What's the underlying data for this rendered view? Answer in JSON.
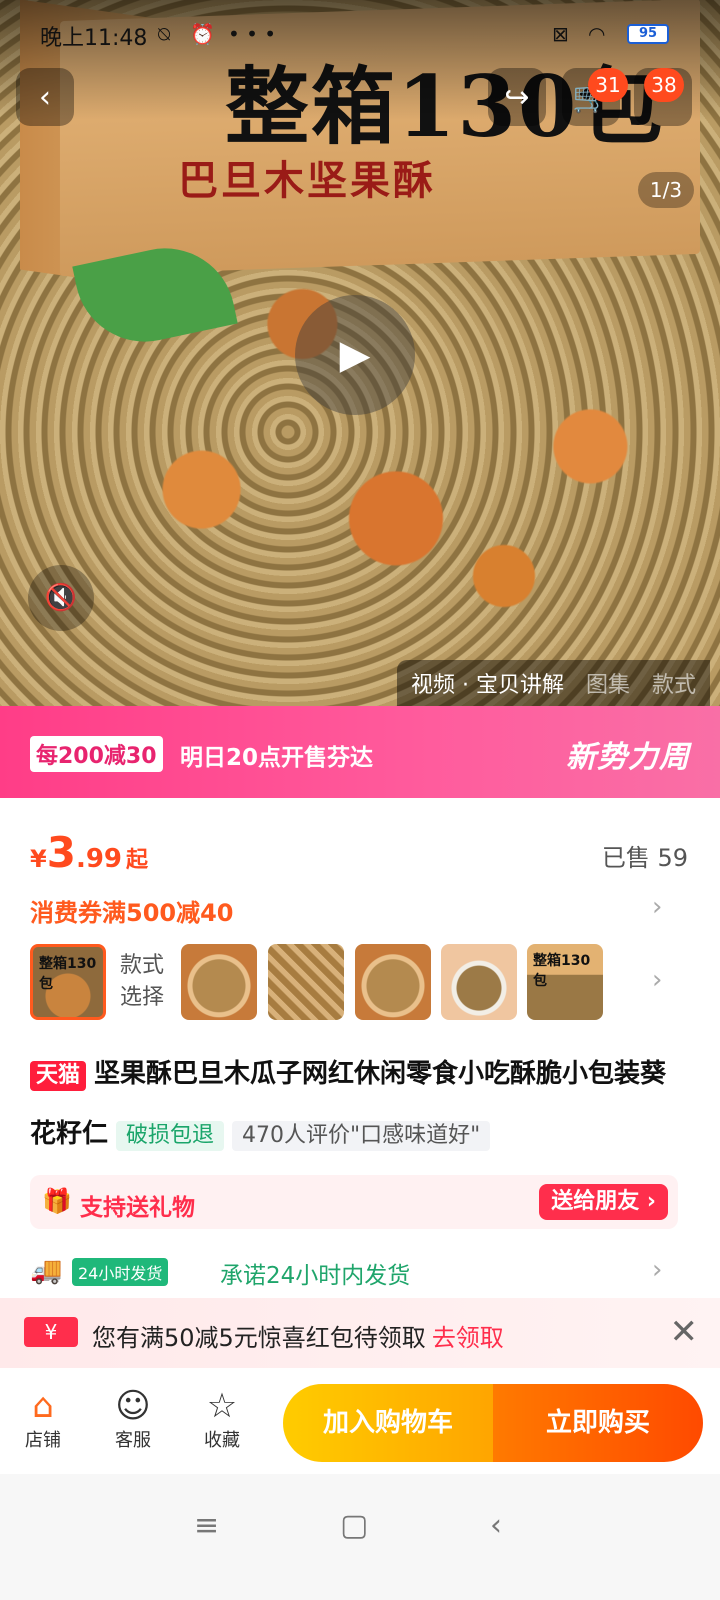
{
  "status_bar": {
    "time": "晚上11:48",
    "battery": "95"
  },
  "hero": {
    "box_title": "整箱130包",
    "box_subtitle": "巴旦木坚果酥",
    "image_counter": "1/3",
    "cart_badge": "31",
    "more_badge": "38",
    "media_tabs": [
      "视频 · 宝贝讲解",
      "图集",
      "款式"
    ]
  },
  "promo": {
    "tag": "每200减30",
    "text": "明日20点开售芬达",
    "brand": "新势力周"
  },
  "price": {
    "currency": "¥",
    "integer": "3",
    "decimal": ".99",
    "suffix": "起",
    "sold_label": "已售 59"
  },
  "coupon": {
    "text": "消费券满500减40"
  },
  "variants": {
    "label_line1": "款式",
    "label_line2": "选择",
    "first_thumb_label": "整箱130包",
    "last_thumb_label": "整箱130包"
  },
  "product": {
    "platform_tag": "天猫",
    "title": "坚果酥巴旦木瓜子网红休闲零食小吃酥脆小包装葵花籽仁",
    "tag_damage": "破损包退",
    "tag_review": "470人评价\"口感味道好\""
  },
  "gift": {
    "text": "支持送礼物",
    "button": "送给朋友 ›"
  },
  "delivery": {
    "badge": "24小时发货",
    "text": "承诺24小时内发货"
  },
  "redpack": {
    "icon": "¥",
    "text": "您有满50减5元惊喜红包待领取",
    "link": "去领取"
  },
  "bottom_bar": {
    "store": "店铺",
    "service": "客服",
    "favorite": "收藏",
    "add_to_cart": "加入购物车",
    "buy_now": "立即购买"
  },
  "colors": {
    "accent": "#ff4a1e",
    "promo_pink": "#ff3d87",
    "green": "#1fa56b"
  }
}
